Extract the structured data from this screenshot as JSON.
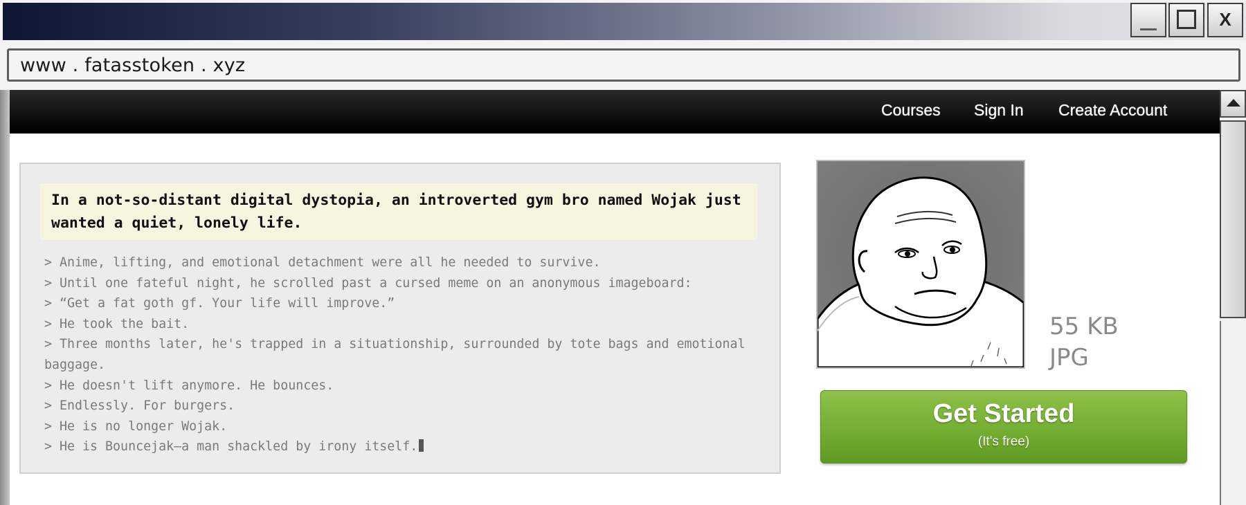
{
  "window": {
    "address": "www . fatasstoken . xyz",
    "close_label": "X"
  },
  "nav": {
    "courses": "Courses",
    "sign_in": "Sign In",
    "create_account": "Create Account"
  },
  "story": {
    "headline": "In a not-so-distant digital dystopia, an introverted gym bro named Wojak just wanted a quiet, lonely life.",
    "lines": [
      "> Anime, lifting, and emotional detachment were all he needed to survive.",
      "> Until one fateful night, he scrolled past a cursed meme on an anonymous imageboard:",
      "> “Get a fat goth gf. Your life will improve.”",
      "> He took the bait.",
      "> Three months later, he's trapped in a situationship, surrounded by tote bags and emotional baggage.",
      "> He doesn't lift anymore. He bounces.",
      "> Endlessly. For burgers.",
      "> He is no longer Wojak.",
      "> He is Bouncejak—a man shackled by irony itself."
    ]
  },
  "file": {
    "size": "55 KB",
    "type": "JPG"
  },
  "cta": {
    "title": "Get Started",
    "subtitle": "(It's free)"
  }
}
